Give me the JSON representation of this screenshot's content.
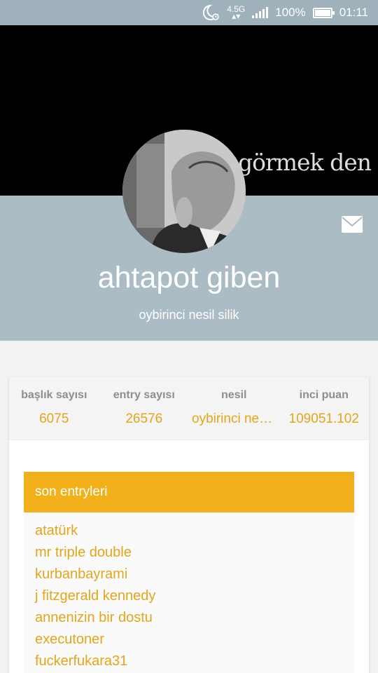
{
  "status_bar": {
    "network": "4.5G",
    "battery": "100%",
    "time": "01:11",
    "icons": [
      "moon-alarm-icon",
      "data-arrows-icon",
      "signal-icon",
      "battery-icon"
    ]
  },
  "cover": {
    "text": "görmek den"
  },
  "profile": {
    "username": "ahtapot giben",
    "subtitle": "oybirinci nesil silik"
  },
  "stats": [
    {
      "label": "başlık sayısı",
      "value": "6075"
    },
    {
      "label": "entry sayısı",
      "value": "26576"
    },
    {
      "label": "nesil",
      "value": "oybirinci nesil silik"
    },
    {
      "label": "inci puan",
      "value": "109051.102"
    }
  ],
  "entries": {
    "title": "son entryleri",
    "items": [
      "atatürk",
      "mr triple double",
      "kurbanbayrami",
      "j fitzgerald kennedy",
      "annenizin bir dostu",
      "executoner",
      "fuckerfukara31"
    ]
  },
  "colors": {
    "accent": "#f2b01a",
    "link": "#e3a51b",
    "header_bg": "#acbcc4",
    "status_bg": "#9fb1bb"
  }
}
